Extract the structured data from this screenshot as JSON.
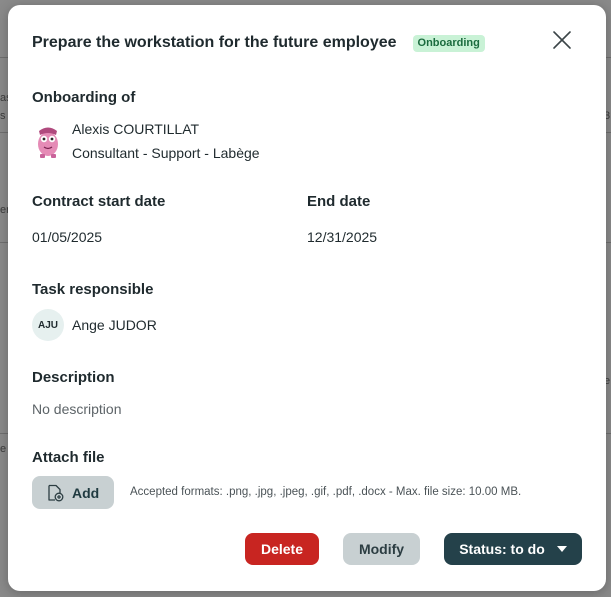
{
  "modal": {
    "title": "Prepare the workstation for the future employee",
    "badge": "Onboarding",
    "badge_color": "#c9f2d6"
  },
  "onboarding": {
    "section_title": "Onboarding of",
    "employee_name": "Alexis COURTILLAT",
    "employee_role": "Consultant - Support - Labège"
  },
  "contract": {
    "start_title": "Contract start date",
    "start_value": "01/05/2025",
    "end_title": "End date",
    "end_value": "12/31/2025"
  },
  "responsible": {
    "section_title": "Task responsible",
    "initials": "AJU",
    "name": "Ange JUDOR"
  },
  "description": {
    "section_title": "Description",
    "value": "No description"
  },
  "attach": {
    "section_title": "Attach file",
    "add_label": "Add",
    "formats": "Accepted formats: .png, .jpg, .jpeg, .gif, .pdf, .docx - Max. file size: 10.00 MB."
  },
  "actions": {
    "delete_label": "Delete",
    "modify_label": "Modify",
    "status_label": "Status: to do"
  },
  "background": {
    "fragments": [
      "as",
      "s",
      "3",
      "er",
      "e",
      "e"
    ]
  },
  "colors": {
    "delete": "#c82521",
    "status": "#24414a",
    "secondary": "#c8d0d2"
  }
}
